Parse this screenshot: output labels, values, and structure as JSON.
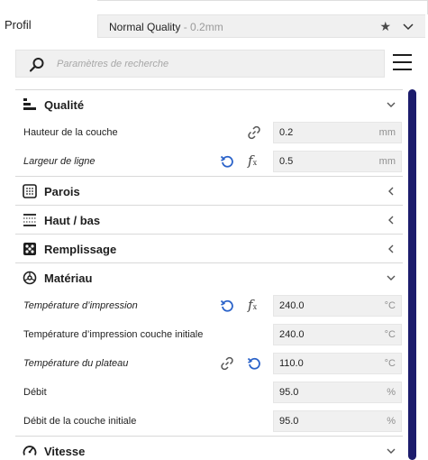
{
  "profile": {
    "label": "Profil",
    "selected_name": "Normal Quality",
    "selected_sub": " - 0.2mm"
  },
  "search": {
    "placeholder": "Paramètres de recherche"
  },
  "colors": {
    "accent": "#1c1c6c",
    "reset_blue": "#2a62c9"
  },
  "categories": [
    {
      "name": "Qualité",
      "icon": "quality-bars-icon",
      "expanded": true,
      "settings": [
        {
          "label": "Hauteur de la couche",
          "italic": false,
          "value": "0.2",
          "unit": "mm",
          "link": true,
          "reset": false,
          "fx": false
        },
        {
          "label": "Largeur de ligne",
          "italic": true,
          "value": "0.5",
          "unit": "mm",
          "link": false,
          "reset": true,
          "fx": true
        }
      ]
    },
    {
      "name": "Parois",
      "icon": "walls-grid-icon",
      "expanded": false
    },
    {
      "name": "Haut / bas",
      "icon": "top-bottom-icon",
      "expanded": false
    },
    {
      "name": "Remplissage",
      "icon": "infill-icon",
      "expanded": false
    },
    {
      "name": "Matériau",
      "icon": "material-icon",
      "expanded": true,
      "settings": [
        {
          "label": "Température d’impression",
          "italic": true,
          "value": "240.0",
          "unit": "°C",
          "link": false,
          "reset": true,
          "fx": true
        },
        {
          "label": "Température d’impression couche initiale",
          "italic": false,
          "value": "240.0",
          "unit": "°C",
          "link": false,
          "reset": false,
          "fx": false
        },
        {
          "label": "Température du plateau",
          "italic": true,
          "value": "110.0",
          "unit": "°C",
          "link": true,
          "reset": true,
          "fx": false
        },
        {
          "label": "Débit",
          "italic": false,
          "value": "95.0",
          "unit": "%",
          "link": false,
          "reset": false,
          "fx": false
        },
        {
          "label": "Débit de la couche initiale",
          "italic": false,
          "value": "95.0",
          "unit": "%",
          "link": false,
          "reset": false,
          "fx": false
        }
      ]
    },
    {
      "name": "Vitesse",
      "icon": "speed-gauge-icon",
      "expanded": true
    }
  ]
}
